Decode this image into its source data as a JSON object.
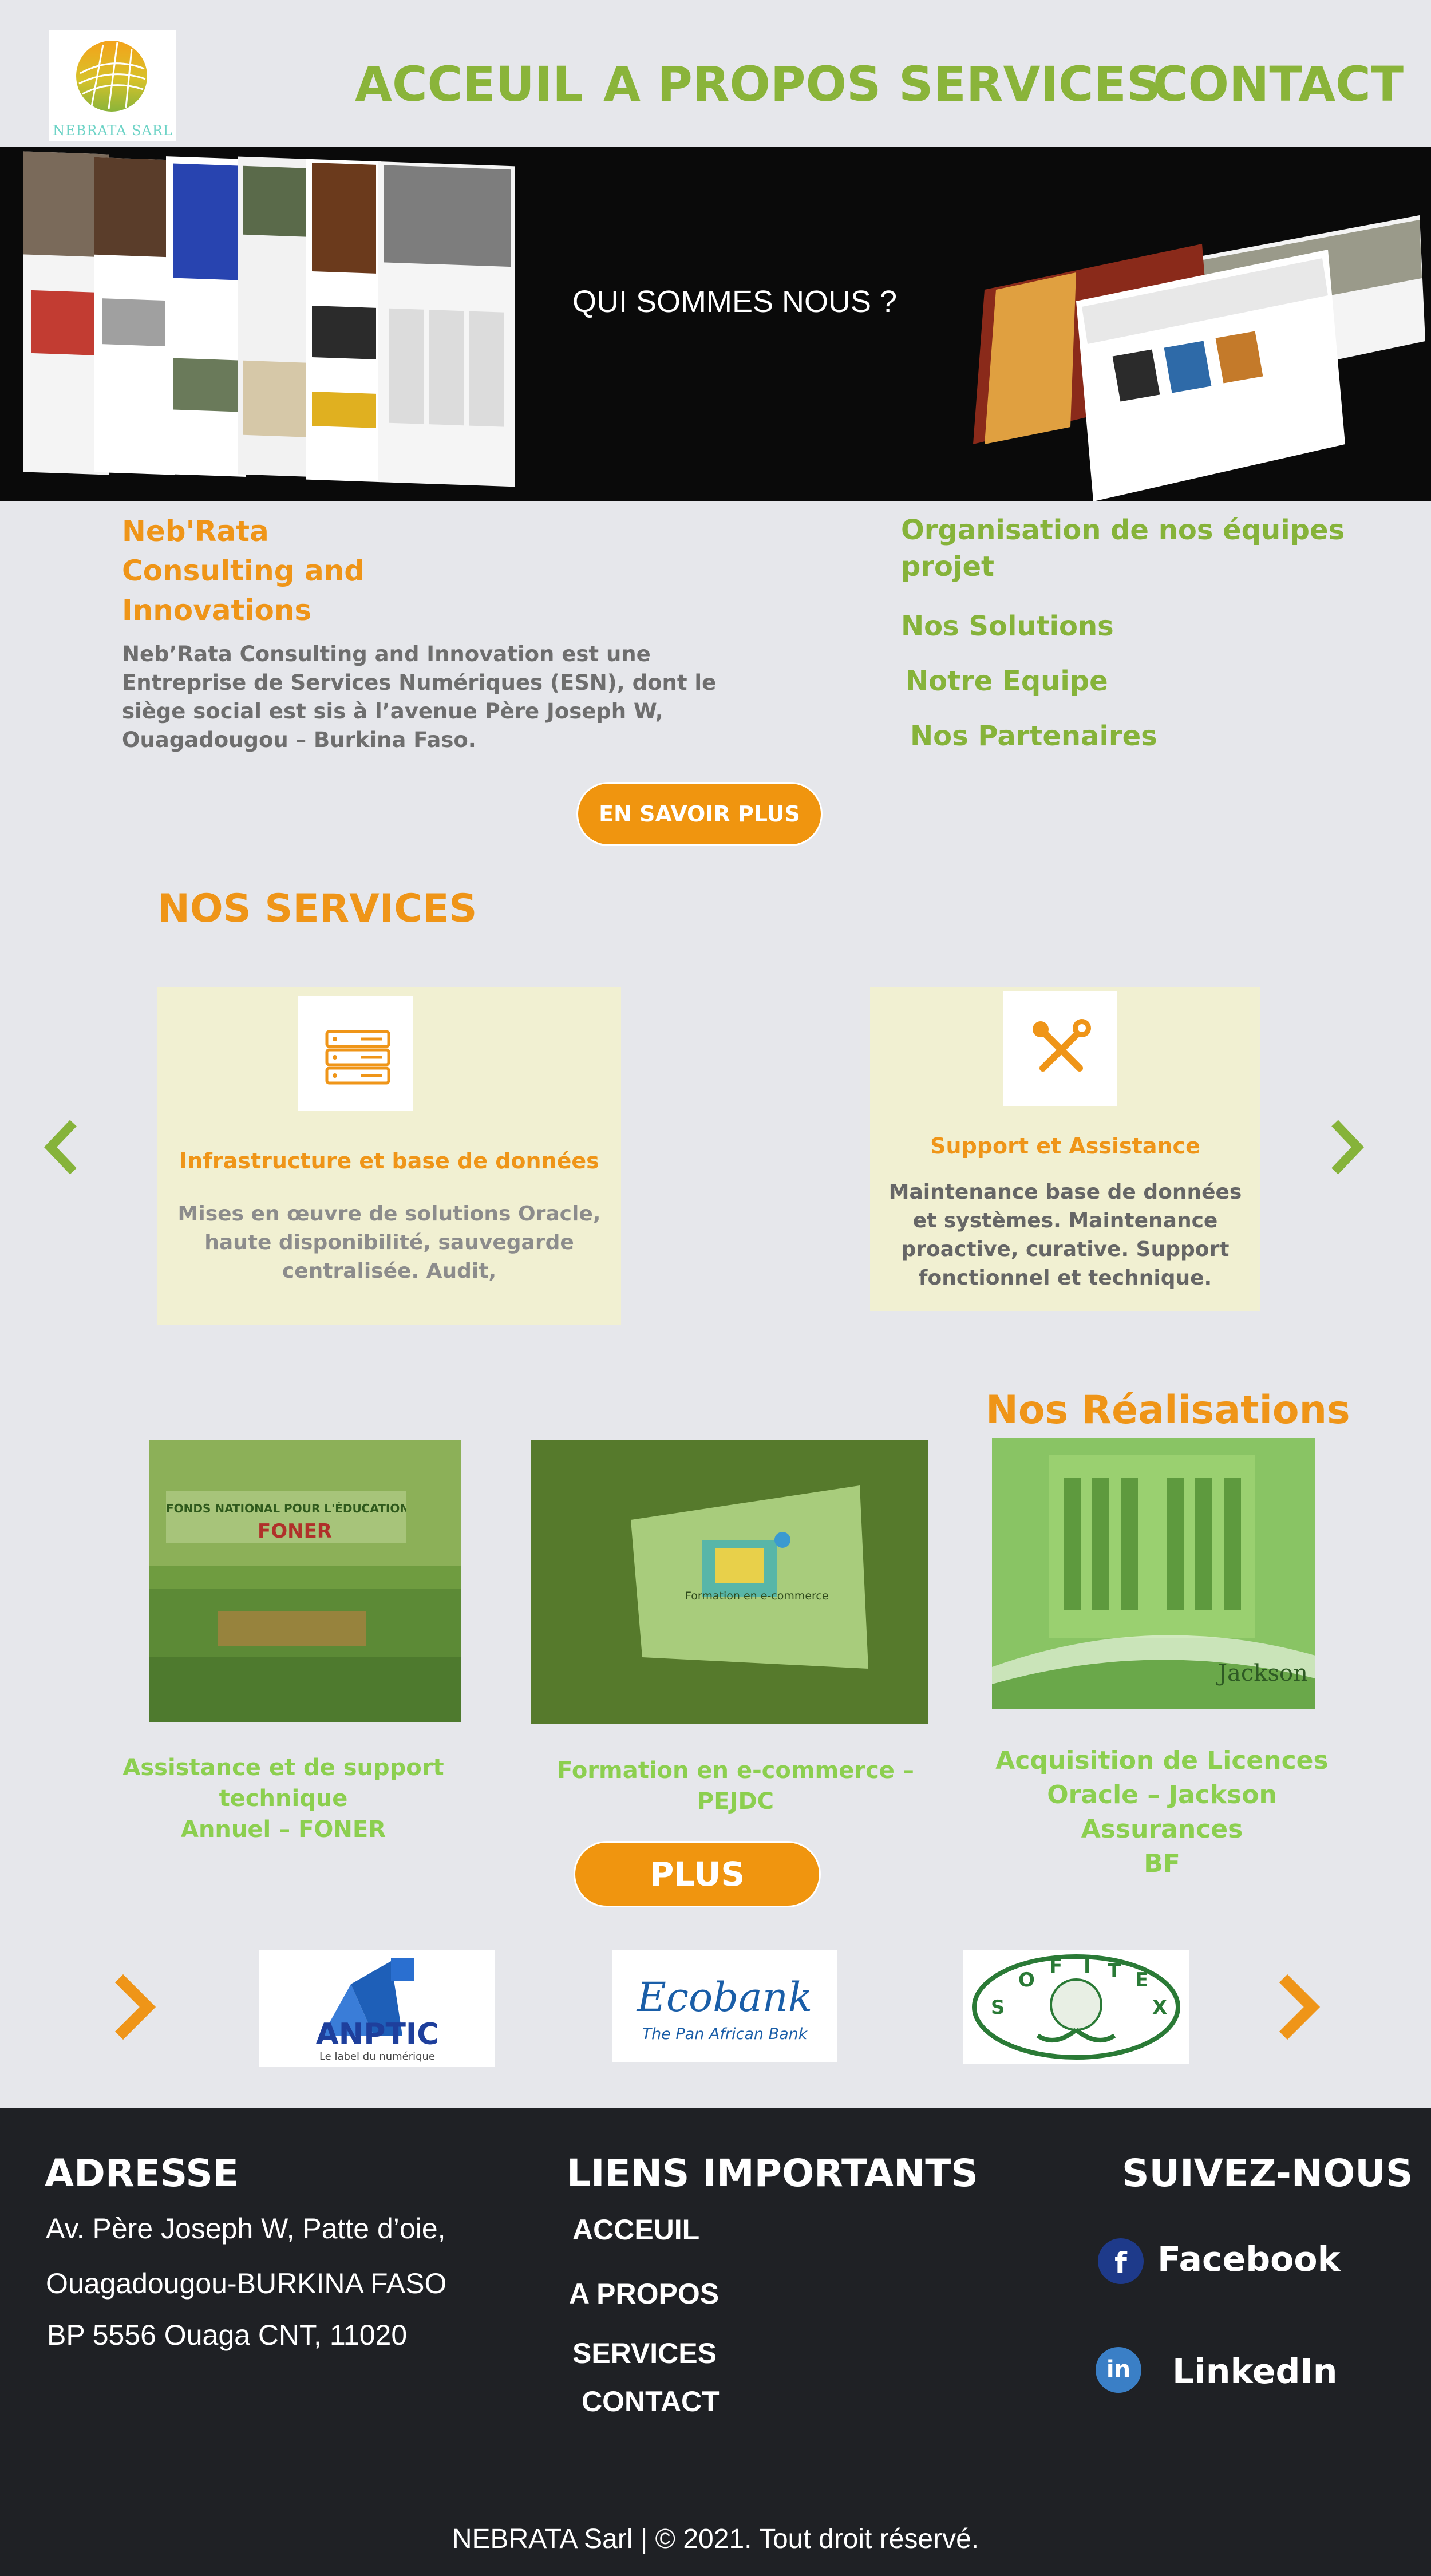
{
  "header": {
    "logo_text": "NEBRATA SARL",
    "nav": [
      "ACCEUIL",
      "A PROPOS",
      "SERVICES",
      "CONTACT"
    ]
  },
  "hero": {
    "title": "QUI SOMMES NOUS ?"
  },
  "about": {
    "company_title_lines": [
      "Neb'Rata",
      "Consulting and",
      "Innovations"
    ],
    "description_lines": [
      "Neb’Rata Consulting and Innovation est une",
      "Entreprise de Services Numériques (ESN), dont le",
      "siège social est sis à l’avenue Père Joseph W,",
      "Ouagadougou – Burkina Faso."
    ],
    "links": [
      "Organisation de nos équipes",
      "projet",
      "Nos Solutions",
      "Notre Equipe",
      "Nos Partenaires"
    ],
    "cta": "EN SAVOIR PLUS"
  },
  "services": {
    "heading": "NOS SERVICES",
    "cards": [
      {
        "title": "Infrastructure et base de données",
        "text_lines": [
          "Mises en œuvre de solutions Oracle,",
          "haute disponibilité, sauvegarde",
          "centralisée. Audit,"
        ]
      },
      {
        "title": "Support et Assistance",
        "text_lines": [
          "Maintenance base de données",
          "et systèmes. Maintenance",
          "proactive, curative. Support",
          "fonctionnel et technique."
        ]
      }
    ]
  },
  "realisations": {
    "heading": "Nos Réalisations",
    "items": [
      {
        "caption_lines": [
          "Assistance et de support technique",
          "Annuel – FONER"
        ],
        "photo_text": [
          "FONDS NATIONAL POUR L'ÉDUCATION ET LA RECHERCHE",
          "FONER"
        ]
      },
      {
        "caption_lines": [
          "Formation en e-commerce – PEJDC"
        ],
        "photo_text": [
          "Formation en e-commerce"
        ]
      },
      {
        "caption_lines": [
          "Acquisition de Licences",
          "Oracle – Jackson Assurances",
          "BF"
        ],
        "photo_text": [
          "Jackson"
        ]
      }
    ],
    "more_button": "PLUS"
  },
  "partners": [
    {
      "name": "ANPTIC",
      "tagline": "Le label du numérique"
    },
    {
      "name": "Ecobank",
      "tagline": "The Pan African Bank"
    },
    {
      "name": "SOFITEX",
      "tagline": ""
    }
  ],
  "footer": {
    "address_heading": "ADRESSE",
    "address_lines": [
      "Av. Père Joseph W, Patte d’oie,",
      "Ouagadougou-BURKINA FASO",
      "BP 5556 Ouaga CNT, 11020"
    ],
    "links_heading": "LIENS IMPORTANTS",
    "links": [
      "ACCEUIL",
      "A PROPOS",
      "SERVICES",
      "CONTACT"
    ],
    "social_heading": "SUIVEZ-NOUS",
    "social": [
      "Facebook",
      "LinkedIn"
    ],
    "copyright": "NEBRATA Sarl | © 2021. Tout droit réservé."
  },
  "colors": {
    "green": "#86b33a",
    "orange": "#ef9518",
    "footer_bg": "#1f2125",
    "page_bg": "#e6e7eb"
  }
}
